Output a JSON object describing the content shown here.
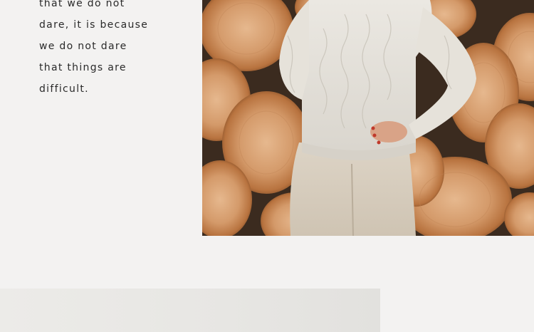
{
  "quote": {
    "lines": [
      "that we do not",
      "dare, it is because",
      "we do not dare",
      "that things are",
      "difficult."
    ]
  }
}
